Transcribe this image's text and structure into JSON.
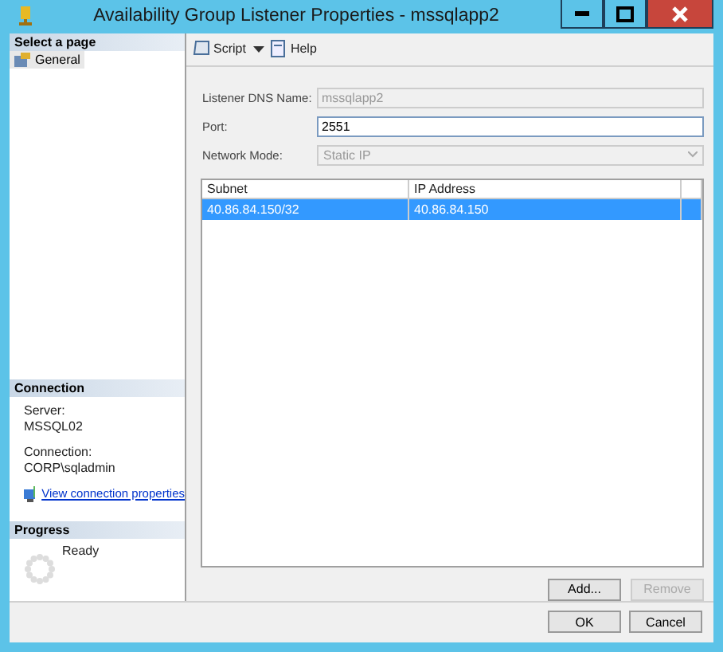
{
  "window": {
    "title": "Availability Group Listener Properties - mssqlapp2"
  },
  "sidebar": {
    "header": "Select a page",
    "items": [
      {
        "label": "General",
        "selected": true
      }
    ]
  },
  "connection": {
    "header": "Connection",
    "server_label": "Server:",
    "server": "MSSQL02",
    "connection_label": "Connection:",
    "connection": "CORP\\sqladmin",
    "link": "View connection properties"
  },
  "progress": {
    "header": "Progress",
    "status": "Ready"
  },
  "toolbar": {
    "script": "Script",
    "help": "Help"
  },
  "form": {
    "dns_label": "Listener DNS Name:",
    "dns_value": "mssqlapp2",
    "port_label": "Port:",
    "port_value": "2551",
    "mode_label": "Network Mode:",
    "mode_value": "Static IP"
  },
  "table": {
    "columns": [
      "Subnet",
      "IP Address"
    ],
    "rows": [
      {
        "cells": [
          "40.86.84.150/32",
          "40.86.84.150"
        ],
        "selected": true
      }
    ]
  },
  "grid_buttons": [
    {
      "label": "Add...",
      "disabled": false
    },
    {
      "label": "Remove",
      "disabled": true
    }
  ],
  "buttons": [
    "OK",
    "Cancel"
  ]
}
